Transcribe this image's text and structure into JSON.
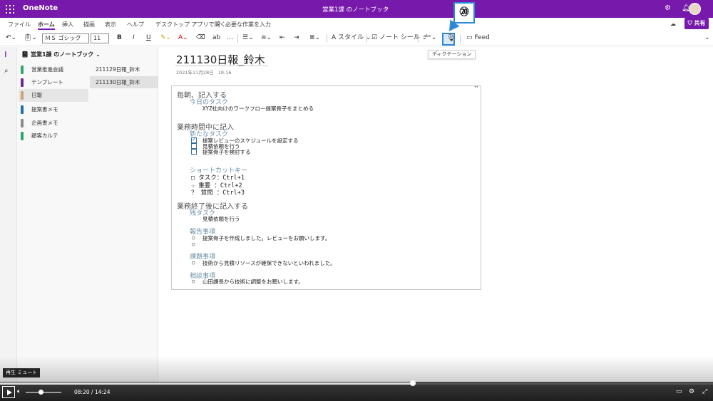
{
  "app": {
    "name": "OneNote",
    "notebook_title": "営業1課 のノートブック",
    "share_label": "共有"
  },
  "menu_tabs": [
    "ファイル",
    "ホーム",
    "挿入",
    "描画",
    "表示",
    "ヘルプ",
    "デスクトップ アプリで開く",
    "必要な作業を入力"
  ],
  "toolbar": {
    "font_name": "ＭＳ ゴシック",
    "font_size": "11",
    "bold": "B",
    "italic": "I",
    "underline": "U",
    "styles_label": "スタイル",
    "note_tags_label": "ノート シール",
    "feed_label": "Feed"
  },
  "callout": {
    "number": "⑳"
  },
  "tooltip": {
    "text": "ディクテーション"
  },
  "sidebar": {
    "notebook": "営業1課 のノートブック",
    "sections": [
      {
        "label": "営業推進会議",
        "color": "#2ea86a"
      },
      {
        "label": "テンプレート",
        "color": "#6a2b9a"
      },
      {
        "label": "日報",
        "color": "#c9a27a"
      },
      {
        "label": "提案書メモ",
        "color": "#1f6fa3"
      },
      {
        "label": "企画書メモ",
        "color": "#8a8a8a"
      },
      {
        "label": "顧客カルテ",
        "color": "#2ea86a"
      }
    ],
    "pages": [
      "211129日報_鈴木",
      "211130日報_鈴木"
    ]
  },
  "page": {
    "title": "211130日報_鈴木",
    "date": "2021年11月28日",
    "time": "18:16",
    "content": {
      "h_morning": "毎朝、記入する",
      "h_today_task": "今日のタスク",
      "today_task": "XYZ社向けのワークフロー提案骨子をまとめる",
      "h_during": "業務時間中に記入",
      "h_new_task": "新たなタスク",
      "tasks": [
        "提案レビューのスケジュールを設定する",
        "見積依頼を行う",
        "提案骨子を検討する"
      ],
      "h_shortcut": "ショートカットキー",
      "shortcuts": [
        "□ タスク：Ctrl+1",
        "☆ 重要 ：Ctrl+2",
        "？ 質問 ：Ctrl+3"
      ],
      "h_after": "業務終了後に記入する",
      "h_remaining": "残タスク",
      "remaining": "見積依頼を行う",
      "h_report": "報告事項",
      "report": "提案骨子を作成しました。レビューをお願いします。",
      "h_issue": "課題事項",
      "issue": "技術から見積リソースが確保できないといわれました。",
      "h_consult": "相談事項",
      "consult": "山田課長から技術に調整をお願いします。"
    }
  },
  "player": {
    "tooltip": "再生 ミュート",
    "current_time": "08:20",
    "separator": "/",
    "duration": "14:24",
    "progress": 0.579
  }
}
